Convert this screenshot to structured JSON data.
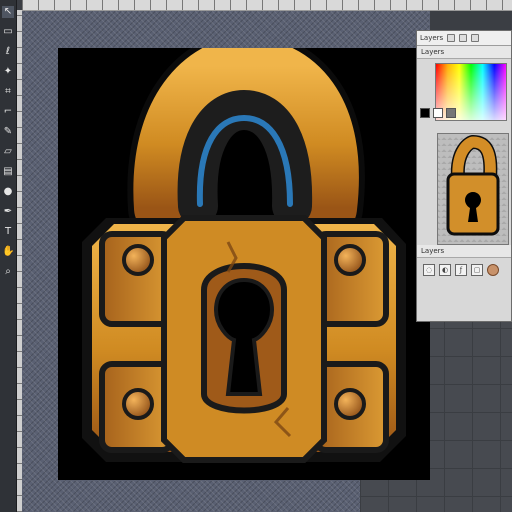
{
  "app": {
    "panel_tabs": [
      "Layers"
    ],
    "sections": {
      "top": "Layers",
      "lower": "Layers"
    },
    "icons": {
      "tools": [
        "move-icon",
        "marquee-icon",
        "lasso-icon",
        "wand-icon",
        "crop-icon",
        "eyedropper-icon",
        "brush-icon",
        "eraser-icon",
        "gradient-icon",
        "dodge-icon",
        "pen-icon",
        "type-icon",
        "hand-icon",
        "zoom-icon"
      ],
      "panel": [
        "search-icon",
        "brush-preset-icon",
        "settings-icon"
      ]
    },
    "colors": {
      "canvas_bg": "#000000",
      "lock_gold": "#d79a2c",
      "lock_gold_dark": "#8a4e16",
      "accent_blue": "#2c83c9"
    }
  }
}
